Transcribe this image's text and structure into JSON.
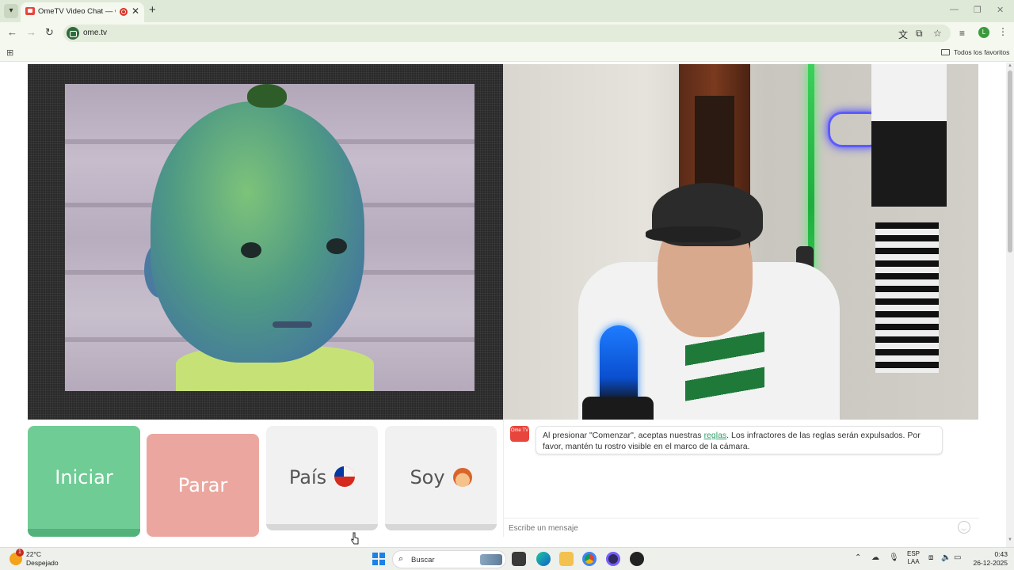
{
  "browser": {
    "tab": {
      "title": "OmeTV Video Chat — Ome"
    },
    "address": {
      "url": "ome.tv"
    },
    "bookmarks": {
      "all_favorites": "Todos los favoritos"
    },
    "window_controls": {
      "minimize": "—",
      "restore": "❐",
      "close": "✕"
    }
  },
  "page": {
    "buttons": {
      "start": "Iniciar",
      "stop": "Parar",
      "country": "País",
      "gender": "Soy"
    },
    "chat": {
      "logo_text": "Ome TV",
      "message_before_link": "Al presionar \"Comenzar\", aceptas nuestras ",
      "message_link": "reglas",
      "message_after_link": ". Los infractores de las reglas serán expulsados. Por favor, mantén tu rostro visible en el marco de la cámara.",
      "input_placeholder": "Escribe un mensaje"
    }
  },
  "taskbar": {
    "weather": {
      "temp": "22°C",
      "condition": "Despejado",
      "badge": "1"
    },
    "search_label": "Buscar",
    "language": {
      "line1": "ESP",
      "line2": "LAA"
    },
    "clock": {
      "time": "0:43",
      "date": "26-12-2025"
    }
  },
  "colors": {
    "start_button": "#6fcc95",
    "stop_button": "#eba79f",
    "link": "#2f9c6a",
    "brand_red": "#e8453c"
  },
  "icons": [
    "tab-list-icon",
    "record-icon",
    "close-tab-icon",
    "new-tab-icon",
    "back-icon",
    "forward-icon",
    "reload-icon",
    "site-info-icon",
    "translate-icon",
    "install-icon",
    "star-icon",
    "media-icon",
    "profile-icon",
    "menu-icon",
    "apps-icon",
    "folder-icon",
    "chile-flag-icon",
    "boy-emoji-icon",
    "emoji-icon",
    "weather-icon",
    "windows-start-icon",
    "search-icon"
  ]
}
